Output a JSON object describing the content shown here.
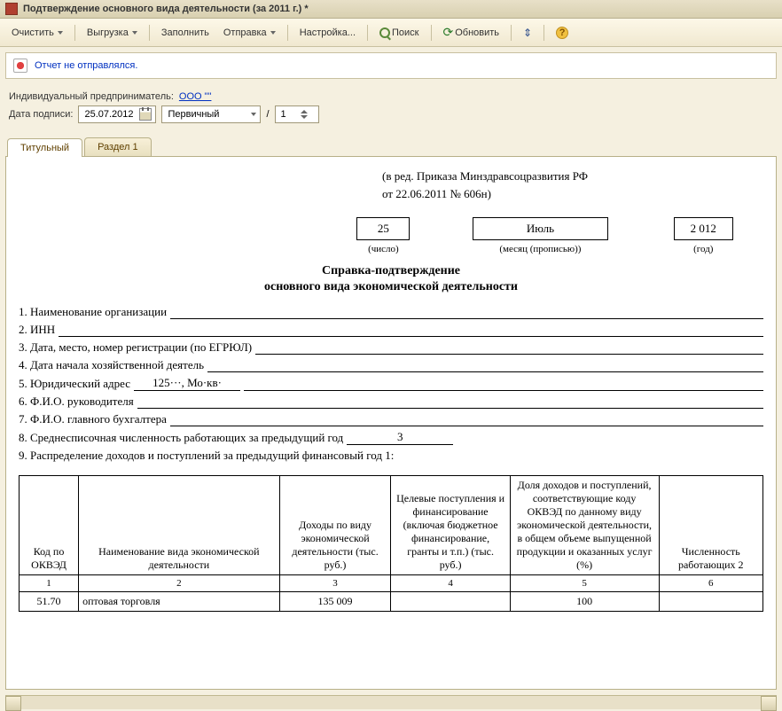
{
  "window": {
    "title": "Подтверждение основного вида деятельности  (за 2011 г.) *"
  },
  "toolbar": {
    "clear": "Очистить",
    "export": "Выгрузка",
    "fill": "Заполнить",
    "send": "Отправка",
    "settings": "Настройка...",
    "search": "Поиск",
    "refresh": "Обновить"
  },
  "status": {
    "text": "Отчет не отправлялся."
  },
  "form": {
    "entrepreneur_label": "Индивидуальный предприниматель:",
    "entrepreneur_value": "ООО \"\"",
    "sign_date_label": "Дата подписи:",
    "sign_date_value": "25.07.2012",
    "kind_value": "Первичный",
    "seq_sep": "/",
    "seq_value": "1"
  },
  "tabs": {
    "title": "Титульный",
    "sec1": "Раздел 1"
  },
  "doc": {
    "ref1": "(в ред. Приказа Минздравсоцразвития РФ",
    "ref2": "от 22.06.2011 № 606н)",
    "day": "25",
    "month": "Июль",
    "year": "2 012",
    "cap_day": "(число)",
    "cap_month": "(месяц (прописью))",
    "cap_year": "(год)",
    "title": "Справка-подтверждение",
    "subtitle": "основного вида экономической деятельности",
    "l1": "1. Наименование организации",
    "l2": "2. ИНН",
    "l3": "3. Дата, место, номер регистрации (по ЕГРЮЛ)",
    "l4": "4. Дата начала хозяйственной деятель",
    "l5": "5. Юридический адрес",
    "l6": "6. Ф.И.О. руководителя",
    "l7": "7. Ф.И.О. главного бухгалтера",
    "l8": "8. Среднесписочная численность работающих за предыдущий год",
    "v8": "3",
    "l9": "9. Распределение доходов и поступлений за предыдущий финансовый год 1:",
    "v5a": "125···, Мо·кв·",
    "th": {
      "c1": "Код по ОКВЭД",
      "c2": "Наименование вида экономической деятельности",
      "c3": "Доходы по виду экономической деятельности (тыс. руб.)",
      "c4": "Целевые пос­тупления и фи­нансирование (включая бюд­жетное фи­нансирование, гранты и т.п.) (тыс. руб.)",
      "c5": "Доля доходов и поступлений, соответствующие коду ОКВЭД по данному виду экономической деятельности, в общем объеме выпущенной продукции и оказанных услуг (%)",
      "c6": "Численность работающих 2"
    },
    "cn": {
      "c1": "1",
      "c2": "2",
      "c3": "3",
      "c4": "4",
      "c5": "5",
      "c6": "6"
    },
    "row": {
      "c1": "51.70",
      "c2": "оптовая торговля",
      "c3": "135 009",
      "c4": "",
      "c5": "100",
      "c6": ""
    }
  }
}
